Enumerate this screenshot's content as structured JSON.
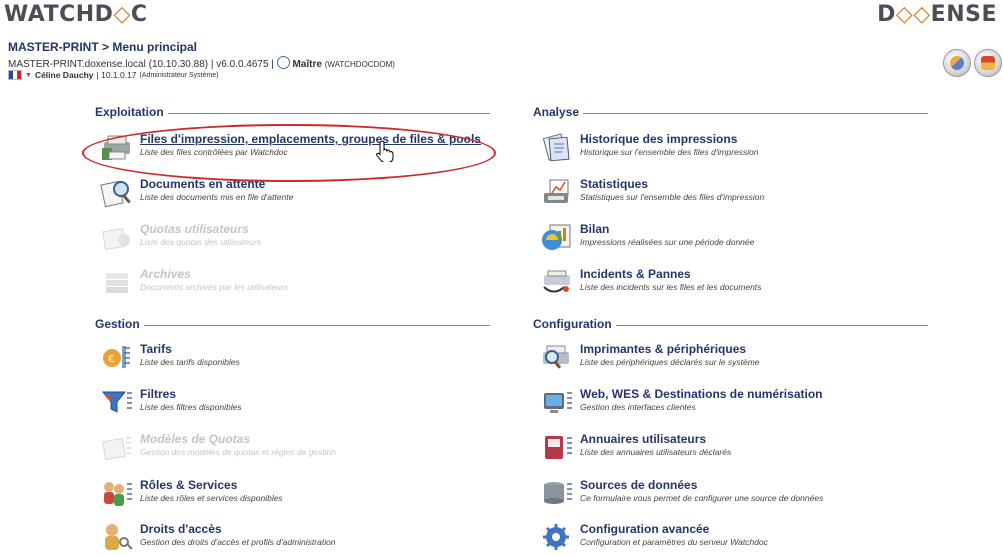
{
  "header": {
    "logo_left": "WATCHDOC",
    "logo_right": "DOXENSE",
    "breadcrumb": "MASTER-PRINT > Menu principal",
    "server_host": "MASTER-PRINT.doxense.local",
    "server_ip": "(10.10.30.88)",
    "separator1": " | ",
    "version": "v6.0.0.4675",
    "separator2": " | ",
    "role": "Maître",
    "role_domain": "(WATCHDOCDOM)",
    "user_name": "Céline Dauchy",
    "user_ip": "| 10.1.0.17",
    "user_role": "(Administrateur Système)"
  },
  "sections": {
    "exploitation": {
      "title": "Exploitation",
      "items": [
        {
          "title": "Files d'impression, emplacements, groupes de files & pools",
          "desc": "Liste des files contrôlées par Watchdoc",
          "icon": "printer-queue-icon"
        },
        {
          "title": "Documents en attente",
          "desc": "Liste des documents mis en file d'attente",
          "icon": "documents-search-icon"
        },
        {
          "title": "Quotas utilisateurs",
          "desc": "Liste des quotas des utilisateurs",
          "icon": "quota-icon"
        },
        {
          "title": "Archives",
          "desc": "Documents archivés par les utilisateurs",
          "icon": "archive-icon"
        }
      ]
    },
    "gestion": {
      "title": "Gestion",
      "items": [
        {
          "title": "Tarifs",
          "desc": "Liste des tarifs disponibles",
          "icon": "tariffs-icon"
        },
        {
          "title": "Filtres",
          "desc": "Liste des filtres disponibles",
          "icon": "filter-icon"
        },
        {
          "title": "Modèles de Quotas",
          "desc": "Gestion des modèles de quotas et règles de gestion",
          "icon": "quota-template-icon"
        },
        {
          "title": "Rôles & Services",
          "desc": "Liste des rôles et services disponibles",
          "icon": "roles-icon"
        },
        {
          "title": "Droits d'accès",
          "desc": "Gestion des droits d'accès et profils d'administration",
          "icon": "access-rights-icon"
        }
      ]
    },
    "analyse": {
      "title": "Analyse",
      "items": [
        {
          "title": "Historique des impressions",
          "desc": "Historique sur l'ensemble des files d'impression",
          "icon": "history-icon"
        },
        {
          "title": "Statistiques",
          "desc": "Statistiques sur l'ensemble des files d'impression",
          "icon": "statistics-icon"
        },
        {
          "title": "Bilan",
          "desc": "Impressions réalisées sur une période donnée",
          "icon": "report-icon"
        },
        {
          "title": "Incidents & Pannes",
          "desc": "Liste des incidents sur les files et les documents",
          "icon": "incidents-icon"
        }
      ]
    },
    "configuration": {
      "title": "Configuration",
      "items": [
        {
          "title": "Imprimantes & périphériques",
          "desc": "Liste des périphériques déclarés sur le système",
          "icon": "printers-icon"
        },
        {
          "title": "Web, WES & Destinations de numérisation",
          "desc": "Gestion des interfaces clientes",
          "icon": "web-wes-icon"
        },
        {
          "title": "Annuaires utilisateurs",
          "desc": "Liste des annuaires utilisateurs déclarés",
          "icon": "directory-icon"
        },
        {
          "title": "Sources de données",
          "desc": "Ce formulaire vous permet de configurer une source de données",
          "icon": "data-source-icon"
        },
        {
          "title": "Configuration avancée",
          "desc": "Configuration et paramètres du serveur Watchdoc",
          "icon": "advanced-config-icon"
        }
      ]
    }
  }
}
